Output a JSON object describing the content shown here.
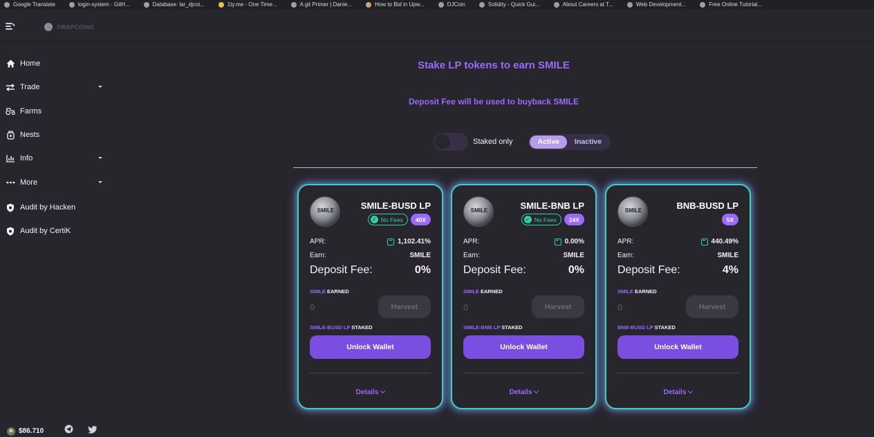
{
  "bookmarks": [
    {
      "label": "Google Translate",
      "icon": "translate-icon"
    },
    {
      "label": "login-system · GitH...",
      "icon": "github-icon"
    },
    {
      "label": "Database: lar_djcoi...",
      "icon": "database-icon"
    },
    {
      "label": "1ty.me - One Time...",
      "icon": "note-icon"
    },
    {
      "label": "A git Primer | Danie...",
      "icon": "globe-icon"
    },
    {
      "label": "How to Bid in Upw...",
      "icon": "upwork-icon"
    },
    {
      "label": "DJCoin",
      "icon": "coin-icon"
    },
    {
      "label": "Solidity - Quick Gui...",
      "icon": "gear-icon"
    },
    {
      "label": "About Careers at T...",
      "icon": "github-icon"
    },
    {
      "label": "Web Development...",
      "icon": "chrome-icon"
    },
    {
      "label": "Free Online Tutorial...",
      "icon": "tutorial-icon"
    }
  ],
  "brand": {
    "logo_text": "SWAPCOING"
  },
  "sidebar": {
    "items": [
      {
        "label": "Home",
        "icon": "home-icon",
        "has_caret": false
      },
      {
        "label": "Trade",
        "icon": "trade-icon",
        "has_caret": true
      },
      {
        "label": "Farms",
        "icon": "tractor-icon",
        "has_caret": false
      },
      {
        "label": "Nests",
        "icon": "nest-icon",
        "has_caret": false
      },
      {
        "label": "Info",
        "icon": "chart-icon",
        "has_caret": true
      },
      {
        "label": "More",
        "icon": "more-icon",
        "has_caret": true
      },
      {
        "label": "Audit by Hacken",
        "icon": "shield-icon",
        "has_caret": false
      },
      {
        "label": "Audit by CertiK",
        "icon": "shield-icon",
        "has_caret": false
      }
    ],
    "footer": {
      "price": "$86.710",
      "icons": [
        "token-icon",
        "telegram-icon",
        "twitter-icon"
      ]
    }
  },
  "main": {
    "headline": "Stake LP tokens to earn SMILE",
    "subheadline": "Deposit Fee will be used to buyback SMILE",
    "staked_only_label": "Staked only",
    "tabs": [
      "Active",
      "Inactive"
    ],
    "active_tab": "Active"
  },
  "labels": {
    "apr": "APR:",
    "earn": "Earn:",
    "deposit_fee": "Deposit Fee:",
    "earned_token": "SMILE",
    "earned_suffix": "EARNED",
    "staked_suffix": "STAKED",
    "harvest": "Harvest",
    "unlock": "Unlock Wallet",
    "details": "Details",
    "no_fees": "No Fees",
    "logo_text": "SMILE"
  },
  "farms": [
    {
      "pair": "SMILE-BUSD LP",
      "no_fees": true,
      "multiplier": "40X",
      "apr": "1,102.41%",
      "earn": "SMILE",
      "deposit_fee": "0%",
      "earned": "0",
      "lp_name": "SMILE-BUSD LP"
    },
    {
      "pair": "SMILE-BNB LP",
      "no_fees": true,
      "multiplier": "24X",
      "apr": "0.00%",
      "earn": "SMILE",
      "deposit_fee": "0%",
      "earned": "0",
      "lp_name": "SMILE-BNB LP"
    },
    {
      "pair": "BNB-BUSD LP",
      "no_fees": false,
      "multiplier": "5X",
      "apr": "440.49%",
      "earn": "SMILE",
      "deposit_fee": "4%",
      "earned": "0",
      "lp_name": "BNB-BUSD LP"
    }
  ],
  "colors": {
    "accent": "#9a6aff",
    "button": "#7a4ee0",
    "success": "#31d0aa",
    "background": "#27262c"
  }
}
